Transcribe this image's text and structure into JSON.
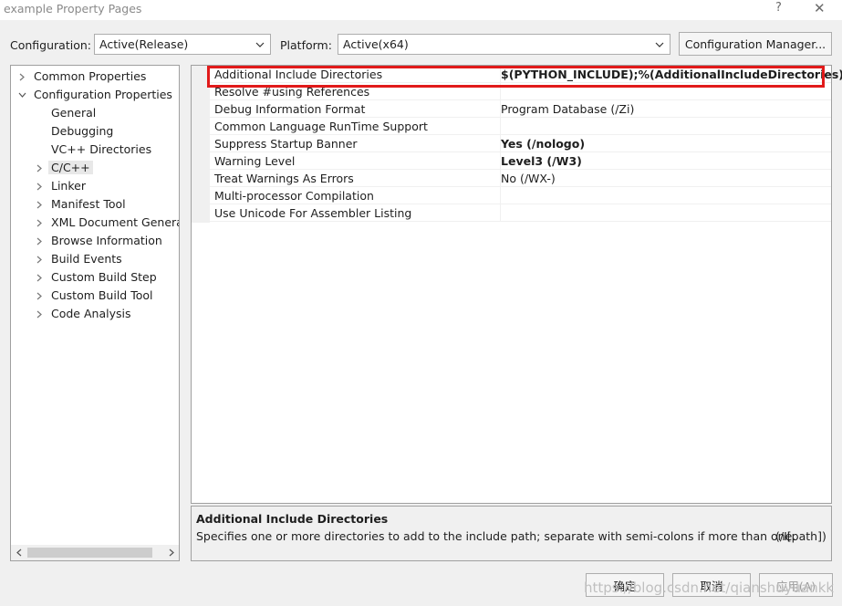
{
  "window": {
    "title": "example Property Pages",
    "help_glyph": "?",
    "close_glyph": "✕"
  },
  "toolbar": {
    "configuration_label": "Configuration:",
    "configuration_value": "Active(Release)",
    "platform_label": "Platform:",
    "platform_value": "Active(x64)",
    "config_manager_label": "Configuration Manager..."
  },
  "tree": {
    "items": [
      {
        "label": "Common Properties",
        "arrow": "collapsed"
      },
      {
        "label": "Configuration Properties",
        "arrow": "expanded"
      },
      {
        "label": "General",
        "arrow": "none"
      },
      {
        "label": "Debugging",
        "arrow": "none"
      },
      {
        "label": "VC++ Directories",
        "arrow": "none"
      },
      {
        "label": "C/C++",
        "arrow": "collapsed",
        "selected": true
      },
      {
        "label": "Linker",
        "arrow": "collapsed"
      },
      {
        "label": "Manifest Tool",
        "arrow": "collapsed"
      },
      {
        "label": "XML Document Generat",
        "arrow": "collapsed"
      },
      {
        "label": "Browse Information",
        "arrow": "collapsed"
      },
      {
        "label": "Build Events",
        "arrow": "collapsed"
      },
      {
        "label": "Custom Build Step",
        "arrow": "collapsed"
      },
      {
        "label": "Custom Build Tool",
        "arrow": "collapsed"
      },
      {
        "label": "Code Analysis",
        "arrow": "collapsed"
      }
    ]
  },
  "properties": {
    "rows": [
      {
        "name": "Additional Include Directories",
        "value": "$(PYTHON_INCLUDE);%(AdditionalIncludeDirectories)",
        "bold": true
      },
      {
        "name": "Resolve #using References",
        "value": "",
        "bold": false
      },
      {
        "name": "Debug Information Format",
        "value": "Program Database (/Zi)",
        "bold": false
      },
      {
        "name": "Common Language RunTime Support",
        "value": "",
        "bold": false
      },
      {
        "name": "Suppress Startup Banner",
        "value": "Yes (/nologo)",
        "bold": true
      },
      {
        "name": "Warning Level",
        "value": "Level3 (/W3)",
        "bold": true
      },
      {
        "name": "Treat Warnings As Errors",
        "value": "No (/WX-)",
        "bold": false
      },
      {
        "name": "Multi-processor Compilation",
        "value": "",
        "bold": false
      },
      {
        "name": "Use Unicode For Assembler Listing",
        "value": "",
        "bold": false
      }
    ]
  },
  "description": {
    "title": "Additional Include Directories",
    "text": "Specifies one or more directories to add to the include path; separate with semi-colons if more than one.",
    "switch": "(/I[path])"
  },
  "footer": {
    "ok_label": "确定",
    "cancel_label": "取消",
    "apply_label": "应用(A)"
  },
  "watermark": "https://blog.csdn.net/qianshuyuankk",
  "colors": {
    "highlight_border": "#e11a1a",
    "selection": "#e8e8e8"
  }
}
